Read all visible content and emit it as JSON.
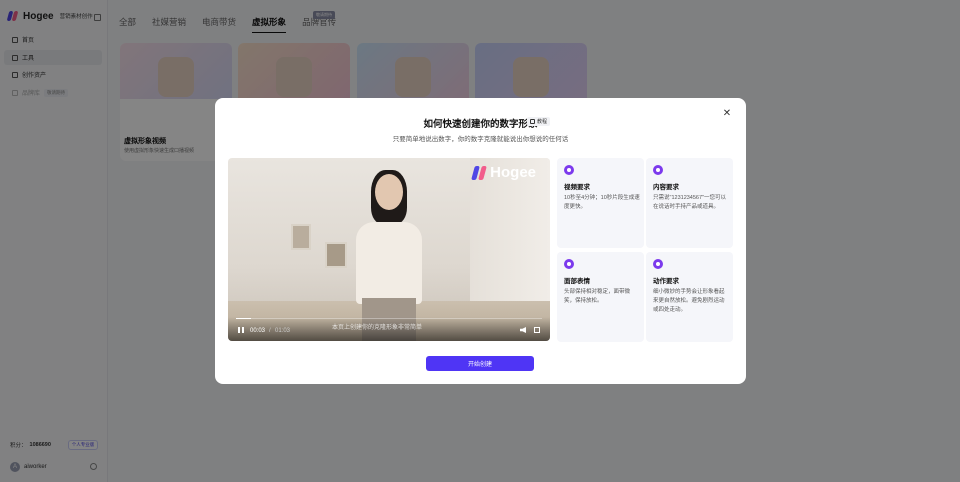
{
  "brand": {
    "name": "Hogee",
    "subtitle": "营销素材创作"
  },
  "sidebar": {
    "items": [
      {
        "label": "首页",
        "icon": "home-icon"
      },
      {
        "label": "工具",
        "icon": "tools-icon"
      },
      {
        "label": "创作资产",
        "icon": "folder-icon"
      },
      {
        "label": "品牌库",
        "icon": "library-icon",
        "badge": "敬请期待"
      }
    ],
    "credits_label": "积分：",
    "credits_value": "1086690",
    "upgrade_label": "个人专业版",
    "user_initial": "A",
    "username": "aiworker"
  },
  "tabs": [
    {
      "label": "全部"
    },
    {
      "label": "社媒营销"
    },
    {
      "label": "电商带货"
    },
    {
      "label": "虚拟形象",
      "active": true
    },
    {
      "label": "品牌官传",
      "badge": "敬请期待"
    }
  ],
  "cards": [
    {
      "title": "虚拟形象视频",
      "desc": "使用虚拟形象快速生成口播视频"
    }
  ],
  "modal": {
    "title": "如何快速创建你的数字形象",
    "tutorial_label": "教程",
    "subtitle": "只要简单地说出数字，你的数字克隆就能说出你想说的任何话",
    "video": {
      "watermark": "Hogee",
      "current_time": "00:03",
      "separator": "/",
      "duration": "01:03",
      "caption": "本页上创建你的克隆形象非常简单",
      "progress": 0.05
    },
    "requirements": [
      {
        "title": "视频要求",
        "desc": "10秒至4分钟；10秒片段生成速度更快。",
        "icon": "video-icon"
      },
      {
        "title": "内容要求",
        "desc": "只需说\"1231234567\"一您可以在说话时手持产品或道具。",
        "icon": "content-icon"
      },
      {
        "title": "面部表情",
        "desc": "头部保持相对稳定，面带微笑，保持放松。",
        "icon": "face-icon"
      },
      {
        "title": "动作要求",
        "desc": "细小微妙的手势会让形象看起来更自然放松。避免剧烈运动或四处走动。",
        "icon": "motion-icon"
      }
    ],
    "start_button": "开始创建"
  },
  "colors": {
    "accent": "#4f35f5",
    "icon_purple": "#7c3aed"
  }
}
